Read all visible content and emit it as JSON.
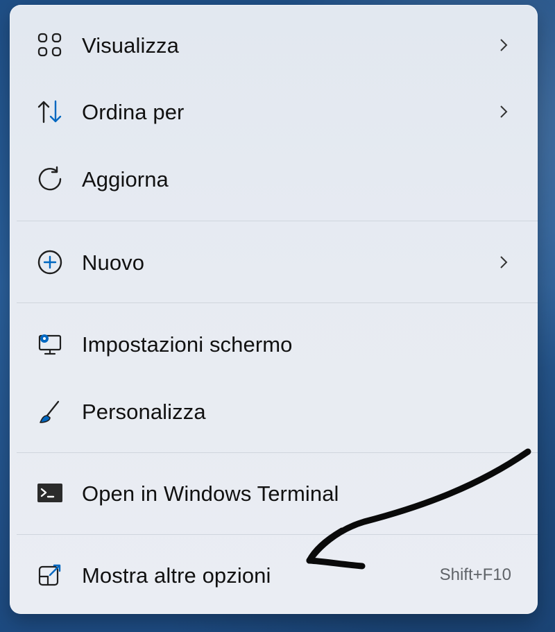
{
  "menu": {
    "items": [
      {
        "label": "Visualizza",
        "icon": "view-grid-icon",
        "has_submenu": true
      },
      {
        "label": "Ordina per",
        "icon": "sort-arrows-icon",
        "has_submenu": true
      },
      {
        "label": "Aggiorna",
        "icon": "refresh-icon",
        "has_submenu": false
      },
      {
        "label": "Nuovo",
        "icon": "add-circle-icon",
        "has_submenu": true
      },
      {
        "label": "Impostazioni schermo",
        "icon": "display-settings-icon",
        "has_submenu": false
      },
      {
        "label": "Personalizza",
        "icon": "paint-brush-icon",
        "has_submenu": false
      },
      {
        "label": "Open in Windows Terminal",
        "icon": "terminal-icon",
        "has_submenu": false
      },
      {
        "label": "Mostra altre opzioni",
        "icon": "show-more-options-icon",
        "has_submenu": false,
        "shortcut": "Shift+F10"
      }
    ]
  },
  "colors": {
    "accent": "#0067c0",
    "text": "#111111",
    "muted": "#5f6368",
    "menu_bg": "#e6eaf1",
    "desktop_bg": "#2a5f9a"
  }
}
